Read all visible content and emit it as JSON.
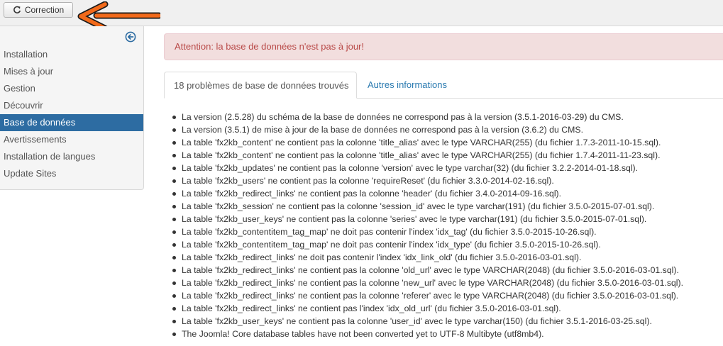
{
  "toolbar": {
    "correction_label": "Correction",
    "accent_arrow_color": "#f26a1b"
  },
  "sidebar": {
    "items": [
      {
        "label": "Installation"
      },
      {
        "label": "Mises à jour"
      },
      {
        "label": "Gestion"
      },
      {
        "label": "Découvrir"
      },
      {
        "label": "Base de données",
        "active": true
      },
      {
        "label": "Avertissements"
      },
      {
        "label": "Installation de langues"
      },
      {
        "label": "Update Sites"
      }
    ],
    "active_color": "#2d6ca2"
  },
  "alert": {
    "text": "Attention: la base de données n'est pas à jour!"
  },
  "tabs": [
    {
      "label": "18 problèmes de base de données trouvés",
      "active": true
    },
    {
      "label": "Autres informations",
      "active": false
    }
  ],
  "problems": [
    "La version (2.5.28) du schéma de la base de données ne correspond pas à la version (3.5.1-2016-03-29) du CMS.",
    "La version (3.5.1) de mise à jour de la base de données ne correspond pas à la version (3.6.2) du CMS.",
    "La table 'fx2kb_content' ne contient pas la colonne 'title_alias' avec le type VARCHAR(255) (du fichier 1.7.3-2011-10-15.sql).",
    "La table 'fx2kb_content' ne contient pas la colonne 'title_alias' avec le type VARCHAR(255) (du fichier 1.7.4-2011-11-23.sql).",
    "La table 'fx2kb_updates' ne contient pas la colonne 'version' avec le type varchar(32) (du fichier 3.2.2-2014-01-18.sql).",
    "La table 'fx2kb_users' ne contient pas la colonne 'requireReset' (du fichier 3.3.0-2014-02-16.sql).",
    "La table 'fx2kb_redirect_links' ne contient pas la colonne 'header' (du fichier 3.4.0-2014-09-16.sql).",
    "La table 'fx2kb_session' ne contient pas la colonne 'session_id' avec le type varchar(191) (du fichier 3.5.0-2015-07-01.sql).",
    "La table 'fx2kb_user_keys' ne contient pas la colonne 'series' avec le type varchar(191) (du fichier 3.5.0-2015-07-01.sql).",
    "La table 'fx2kb_contentitem_tag_map' ne doit pas contenir l'index 'idx_tag' (du fichier 3.5.0-2015-10-26.sql).",
    "La table 'fx2kb_contentitem_tag_map' ne doit pas contenir l'index 'idx_type' (du fichier 3.5.0-2015-10-26.sql).",
    "La table 'fx2kb_redirect_links' ne doit pas contenir l'index 'idx_link_old' (du fichier 3.5.0-2016-03-01.sql).",
    "La table 'fx2kb_redirect_links' ne contient pas la colonne 'old_url' avec le type VARCHAR(2048) (du fichier 3.5.0-2016-03-01.sql).",
    "La table 'fx2kb_redirect_links' ne contient pas la colonne 'new_url' avec le type VARCHAR(2048) (du fichier 3.5.0-2016-03-01.sql).",
    "La table 'fx2kb_redirect_links' ne contient pas la colonne 'referer' avec le type VARCHAR(2048) (du fichier 3.5.0-2016-03-01.sql).",
    "La table 'fx2kb_redirect_links' ne contient pas l'index 'idx_old_url' (du fichier 3.5.0-2016-03-01.sql).",
    "La table 'fx2kb_user_keys' ne contient pas la colonne 'user_id' avec le type varchar(150) (du fichier 3.5.1-2016-03-25.sql).",
    "The Joomla! Core database tables have not been converted yet to UTF-8 Multibyte (utf8mb4)."
  ]
}
